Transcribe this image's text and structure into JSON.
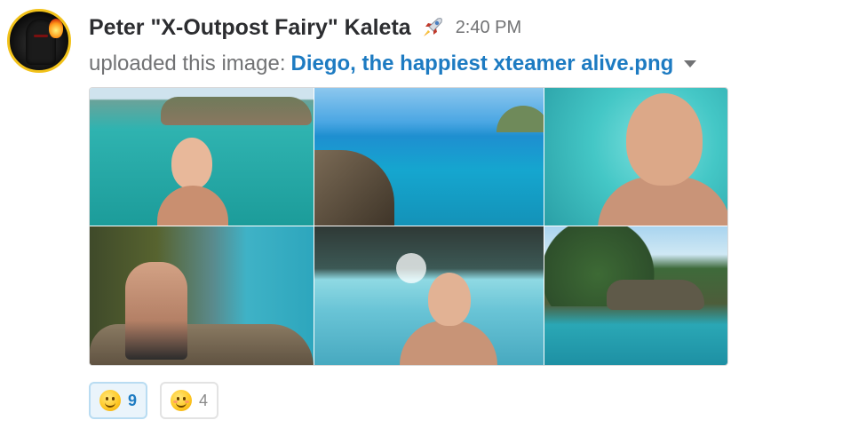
{
  "message": {
    "author": "Peter \"X-Outpost Fairy\" Kaleta",
    "status_icon": "rocket-icon",
    "time": "2:40 PM",
    "action_prefix": "uploaded this image:",
    "filename": "Diego, the happiest xteamer alive.png"
  },
  "reactions": [
    {
      "emoji": "slightly-smiling-face",
      "count": "9",
      "active": true
    },
    {
      "emoji": "blush",
      "count": "4",
      "active": false
    }
  ],
  "colors": {
    "link": "#1d7bc2",
    "muted": "#717274",
    "active_reaction_bg": "#eaf4fb",
    "active_reaction_border": "#b9dcf2"
  }
}
